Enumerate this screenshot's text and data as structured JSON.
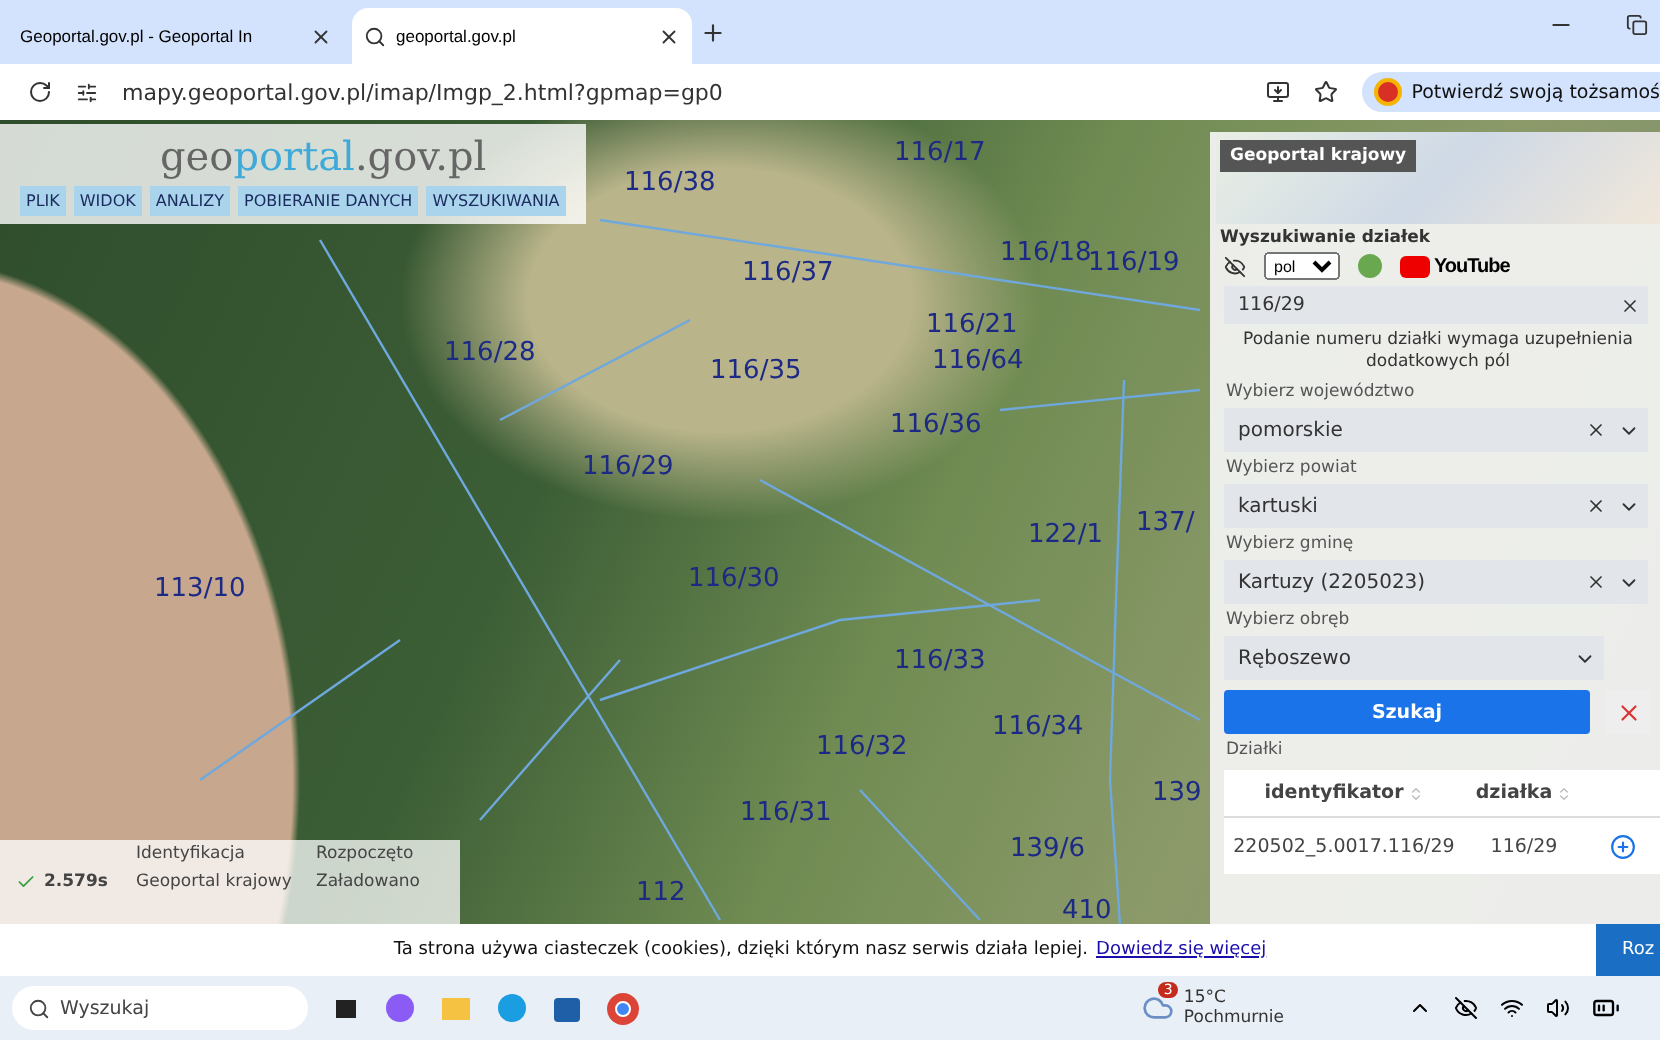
{
  "browser": {
    "tabs": [
      {
        "title": "Geoportal.gov.pl - Geoportal In",
        "selected": false
      },
      {
        "title": "geoportal.gov.pl",
        "selected": true
      }
    ],
    "url": "mapy.geoportal.gov.pl/imap/Imgp_2.html?gpmap=gp0",
    "profile_prompt": "Potwierdź swoją tożsamoś"
  },
  "header": {
    "logo": {
      "prefix": "geo",
      "brand": "portal",
      "suffix": ".gov.pl"
    },
    "menu": [
      "PLIK",
      "WIDOK",
      "ANALIZY",
      "POBIERANIE DANYCH",
      "WYSZUKIWANIA"
    ]
  },
  "map": {
    "parcels": [
      "116/17",
      "116/38",
      "116/37",
      "116/18",
      "116/19",
      "116/28",
      "116/21",
      "116/64",
      "116/35",
      "116/36",
      "116/29",
      "122/1",
      "137/",
      "113/10",
      "116/30",
      "116/33",
      "116/34",
      "116/32",
      "139",
      "116/31",
      "139/6",
      "112",
      "410"
    ]
  },
  "log": {
    "columns": [
      "Identyfikacja",
      "Rozpoczęto"
    ],
    "rows": [
      {
        "time": "2.579s",
        "name": "Geoportal krajowy",
        "status": "Załadowano"
      }
    ]
  },
  "panel": {
    "minimap_title": "Geoportal krajowy",
    "title": "Wyszukiwanie działek",
    "toolbar": {
      "language": "pol",
      "video_brand": "YouTube"
    },
    "search_value": "116/29",
    "note": "Podanie numeru działki wymaga uzupełnienia dodatkowych pól",
    "selects": [
      {
        "label": "Wybierz województwo",
        "value": "pomorskie",
        "clearable": true
      },
      {
        "label": "Wybierz powiat",
        "value": "kartuski",
        "clearable": true
      },
      {
        "label": "Wybierz gminę",
        "value": "Kartuzy (2205023)",
        "clearable": true
      },
      {
        "label": "Wybierz obręb",
        "value": "Ręboszewo",
        "clearable": false
      }
    ],
    "search_button": "Szukaj",
    "results_title": "Działki",
    "columns": [
      "identyfikator",
      "działka"
    ],
    "rows": [
      {
        "id": "220502_5.0017.116/29",
        "parcel": "116/29"
      }
    ]
  },
  "cookie": {
    "text": "Ta strona używa ciasteczek (cookies), dzięki którym nasz serwis działa lepiej.",
    "link": "Dowiedz się więcej",
    "button": "Roz"
  },
  "taskbar": {
    "search": "Wyszukaj",
    "weather_badge": "3",
    "temperature": "15°C",
    "condition": "Pochmurnie"
  }
}
